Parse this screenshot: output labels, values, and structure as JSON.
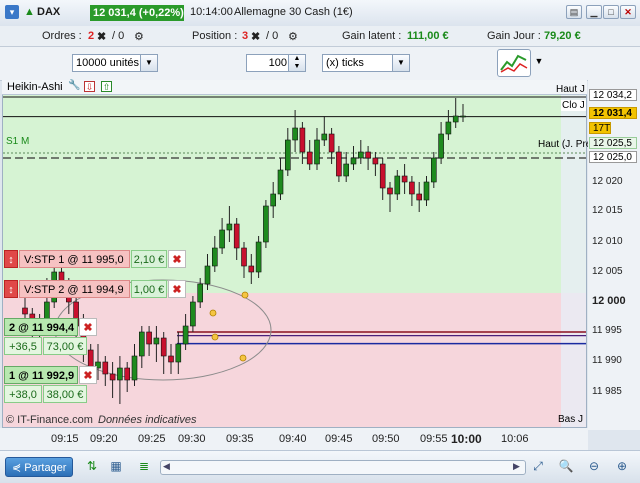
{
  "titlebar": {
    "instrument": "DAX",
    "price_change": "12 031,4 (+0,22%)",
    "time": "10:14:00",
    "market_name": "Allemagne 30 Cash (1€)"
  },
  "positions_bar": {
    "orders_label": "Ordres :",
    "orders_count": "2",
    "orders_zero": "/ 0",
    "position_label": "Position :",
    "position_count": "3",
    "position_zero": "/ 0",
    "latent_label": "Gain latent :",
    "latent_value": "111,00 €",
    "day_label": "Gain Jour :",
    "day_value": "79,20 €"
  },
  "toolbar": {
    "units_value": "10000 unités",
    "ticks_value": "100",
    "ticks_unit": "(x) ticks"
  },
  "chart": {
    "header_title": "Heikin-Ashi",
    "s1_label": "S1 M",
    "haut_j": "Haut J",
    "clo_j": "Clo J",
    "haut_j_prec": "Haut (J. Pré)",
    "bas_j": "Bas J",
    "watermark_brand": "© IT-Finance.com",
    "watermark_note": "Données indicatives"
  },
  "orders": [
    {
      "label": "V:STP  1 @ 11 995,0",
      "amount": "2,10 €"
    },
    {
      "label": "V:STP  2 @ 11 994,9",
      "amount": "1,00 €"
    }
  ],
  "positions": [
    {
      "label": "2 @ 11 994,4",
      "pts": "+36,5",
      "amount": "73,00 €"
    },
    {
      "label": "1 @ 11 992,9",
      "pts": "+38,0",
      "amount": "38,00 €"
    }
  ],
  "price_axis": {
    "labels": [
      "12 020",
      "12 015",
      "12 010",
      "12 005",
      "12 000",
      "11 995",
      "11 990",
      "11 985"
    ],
    "haut_value": "12 034,2",
    "last_value": "12 031,4",
    "ticks_badge": "17T",
    "prev_value": "12 025,5",
    "s1_value": "12 025,0"
  },
  "time_axis": {
    "labels": [
      "09:15",
      "09:20",
      "09:25",
      "09:30",
      "09:35",
      "09:40",
      "09:45",
      "09:50",
      "09:55",
      "10:00",
      "10:06"
    ]
  },
  "bottom_bar": {
    "share_label": "Partager"
  },
  "chart_data": {
    "type": "candlestick-heikin-ashi",
    "ylim": [
      11982,
      12036
    ],
    "candles": [
      {
        "t": "09:12",
        "o": 11999,
        "c": 11998,
        "h": 12001,
        "l": 11996
      },
      {
        "t": "09:13",
        "o": 11998,
        "c": 11995,
        "h": 11999,
        "l": 11993
      },
      {
        "t": "09:14",
        "o": 11995,
        "c": 11997,
        "h": 11998,
        "l": 11993
      },
      {
        "t": "09:15",
        "o": 11997,
        "c": 12000,
        "h": 12004,
        "l": 11996
      },
      {
        "t": "09:16",
        "o": 12000,
        "c": 12005,
        "h": 12007,
        "l": 11999
      },
      {
        "t": "09:17",
        "o": 12005,
        "c": 12003,
        "h": 12006,
        "l": 12001
      },
      {
        "t": "09:18",
        "o": 12003,
        "c": 12000,
        "h": 12004,
        "l": 11998
      },
      {
        "t": "09:19",
        "o": 12000,
        "c": 11996,
        "h": 12001,
        "l": 11994
      },
      {
        "t": "09:20",
        "o": 11996,
        "c": 11992,
        "h": 11998,
        "l": 11990
      },
      {
        "t": "09:21",
        "o": 11992,
        "c": 11989,
        "h": 11993,
        "l": 11987
      },
      {
        "t": "09:22",
        "o": 11989,
        "c": 11990,
        "h": 11993,
        "l": 11987
      },
      {
        "t": "09:23",
        "o": 11990,
        "c": 11988,
        "h": 11991,
        "l": 11986
      },
      {
        "t": "09:24",
        "o": 11988,
        "c": 11987,
        "h": 11990,
        "l": 11984
      },
      {
        "t": "09:25",
        "o": 11987,
        "c": 11989,
        "h": 11991,
        "l": 11983
      },
      {
        "t": "09:26",
        "o": 11989,
        "c": 11987,
        "h": 11990,
        "l": 11985
      },
      {
        "t": "09:27",
        "o": 11987,
        "c": 11991,
        "h": 11993,
        "l": 11986
      },
      {
        "t": "09:28",
        "o": 11991,
        "c": 11995,
        "h": 11996,
        "l": 11989
      },
      {
        "t": "09:29",
        "o": 11995,
        "c": 11993,
        "h": 11996,
        "l": 11991
      },
      {
        "t": "09:30",
        "o": 11993,
        "c": 11994,
        "h": 11996,
        "l": 11990
      },
      {
        "t": "09:31",
        "o": 11994,
        "c": 11991,
        "h": 11995,
        "l": 11988
      },
      {
        "t": "09:32",
        "o": 11991,
        "c": 11990,
        "h": 11993,
        "l": 11988
      },
      {
        "t": "09:33",
        "o": 11990,
        "c": 11993,
        "h": 11995,
        "l": 11988
      },
      {
        "t": "09:34",
        "o": 11993,
        "c": 11996,
        "h": 11998,
        "l": 11992
      },
      {
        "t": "09:35",
        "o": 11996,
        "c": 12000,
        "h": 12001,
        "l": 11995
      },
      {
        "t": "09:36",
        "o": 12000,
        "c": 12003,
        "h": 12004,
        "l": 11999
      },
      {
        "t": "09:37",
        "o": 12003,
        "c": 12006,
        "h": 12008,
        "l": 12002
      },
      {
        "t": "09:38",
        "o": 12006,
        "c": 12009,
        "h": 12011,
        "l": 12005
      },
      {
        "t": "09:39",
        "o": 12009,
        "c": 12012,
        "h": 12014,
        "l": 12008
      },
      {
        "t": "09:40",
        "o": 12012,
        "c": 12013,
        "h": 12016,
        "l": 12010
      },
      {
        "t": "09:41",
        "o": 12013,
        "c": 12009,
        "h": 12014,
        "l": 12007
      },
      {
        "t": "09:42",
        "o": 12009,
        "c": 12006,
        "h": 12010,
        "l": 12004
      },
      {
        "t": "09:43",
        "o": 12006,
        "c": 12005,
        "h": 12008,
        "l": 12003
      },
      {
        "t": "09:44",
        "o": 12005,
        "c": 12010,
        "h": 12011,
        "l": 12004
      },
      {
        "t": "09:45",
        "o": 12010,
        "c": 12016,
        "h": 12017,
        "l": 12009
      },
      {
        "t": "09:46",
        "o": 12016,
        "c": 12018,
        "h": 12020,
        "l": 12014
      },
      {
        "t": "09:47",
        "o": 12018,
        "c": 12022,
        "h": 12024,
        "l": 12017
      },
      {
        "t": "09:48",
        "o": 12022,
        "c": 12027,
        "h": 12029,
        "l": 12021
      },
      {
        "t": "09:49",
        "o": 12027,
        "c": 12029,
        "h": 12032,
        "l": 12025
      },
      {
        "t": "09:50",
        "o": 12029,
        "c": 12025,
        "h": 12030,
        "l": 12023
      },
      {
        "t": "09:51",
        "o": 12025,
        "c": 12023,
        "h": 12027,
        "l": 12022
      },
      {
        "t": "09:52",
        "o": 12023,
        "c": 12027,
        "h": 12029,
        "l": 12022
      },
      {
        "t": "09:53",
        "o": 12027,
        "c": 12028,
        "h": 12031,
        "l": 12026
      },
      {
        "t": "09:54",
        "o": 12028,
        "c": 12025,
        "h": 12029,
        "l": 12023
      },
      {
        "t": "09:55",
        "o": 12025,
        "c": 12021,
        "h": 12026,
        "l": 12020
      },
      {
        "t": "09:56",
        "o": 12021,
        "c": 12023,
        "h": 12025,
        "l": 12020
      },
      {
        "t": "09:57",
        "o": 12023,
        "c": 12024,
        "h": 12026,
        "l": 12022
      },
      {
        "t": "09:58",
        "o": 12024,
        "c": 12025,
        "h": 12027,
        "l": 12023
      },
      {
        "t": "09:59",
        "o": 12025,
        "c": 12024,
        "h": 12026,
        "l": 12022
      },
      {
        "t": "10:00",
        "o": 12024,
        "c": 12023,
        "h": 12025,
        "l": 12021
      },
      {
        "t": "10:01",
        "o": 12023,
        "c": 12019,
        "h": 12024,
        "l": 12017
      },
      {
        "t": "10:02",
        "o": 12019,
        "c": 12018,
        "h": 12020,
        "l": 12015
      },
      {
        "t": "10:03",
        "o": 12018,
        "c": 12021,
        "h": 12022,
        "l": 12017
      },
      {
        "t": "10:04",
        "o": 12021,
        "c": 12020,
        "h": 12023,
        "l": 12018
      },
      {
        "t": "10:05",
        "o": 12020,
        "c": 12018,
        "h": 12021,
        "l": 12016
      },
      {
        "t": "10:06",
        "o": 12018,
        "c": 12017,
        "h": 12020,
        "l": 12015
      },
      {
        "t": "10:07",
        "o": 12017,
        "c": 12020,
        "h": 12021,
        "l": 12016
      },
      {
        "t": "10:08",
        "o": 12020,
        "c": 12024,
        "h": 12025,
        "l": 12019
      },
      {
        "t": "10:09",
        "o": 12024,
        "c": 12028,
        "h": 12030,
        "l": 12023
      },
      {
        "t": "10:10",
        "o": 12028,
        "c": 12030,
        "h": 12032,
        "l": 12027
      },
      {
        "t": "10:11",
        "o": 12030,
        "c": 12031,
        "h": 12034,
        "l": 12029
      },
      {
        "t": "10:12",
        "o": 12031,
        "c": 12031,
        "h": 12033,
        "l": 12030
      }
    ],
    "levels": {
      "haut_j": 12034.2,
      "clo_j": 12031.4,
      "haut_j_prec": 12025.5,
      "s1": 12025.0,
      "order_stop_1": 11995.0,
      "order_stop_2": 11994.9,
      "position_2": 11994.4,
      "position_1": 11992.9
    }
  }
}
